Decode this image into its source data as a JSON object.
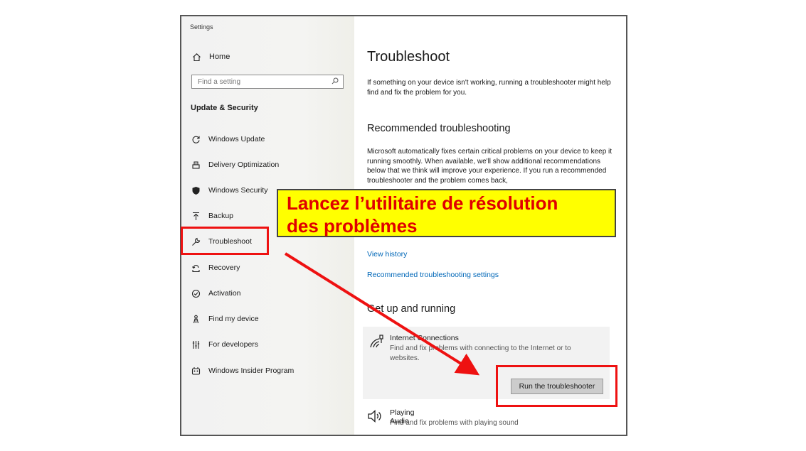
{
  "window": {
    "title": "Settings"
  },
  "sidebar": {
    "home_label": "Home",
    "search_placeholder": "Find a setting",
    "section_title": "Update & Security",
    "items": [
      {
        "label": "Windows Update",
        "icon": "refresh-icon"
      },
      {
        "label": "Delivery Optimization",
        "icon": "delivery-icon"
      },
      {
        "label": "Windows Security",
        "icon": "shield-icon"
      },
      {
        "label": "Backup",
        "icon": "backup-arrow-icon"
      },
      {
        "label": "Troubleshoot",
        "icon": "wrench-icon",
        "selected": true
      },
      {
        "label": "Recovery",
        "icon": "recovery-icon"
      },
      {
        "label": "Activation",
        "icon": "check-circle-icon"
      },
      {
        "label": "Find my device",
        "icon": "person-location-icon"
      },
      {
        "label": "For developers",
        "icon": "developer-icon"
      },
      {
        "label": "Windows Insider Program",
        "icon": "insider-icon"
      }
    ]
  },
  "main": {
    "title": "Troubleshoot",
    "intro": "If something on your device isn't working, running a troubleshooter might help find and fix the problem for you.",
    "recommended_title": "Recommended troubleshooting",
    "recommended_text": "Microsoft automatically fixes certain critical problems on your device to keep it running smoothly. When available, we'll show additional recommendations below that we think will improve your experience. If you run a recommended troubleshooter and the problem comes back,",
    "link_history": "View history",
    "link_settings": "Recommended troubleshooting settings",
    "getup_title": "Get up and running",
    "internet": {
      "title": "Internet Connections",
      "desc": "Find and fix problems with connecting to the Internet or to websites.",
      "button": "Run the troubleshooter"
    },
    "audio": {
      "title": "Playing Audio",
      "desc": "Find and fix problems with playing sound"
    }
  },
  "annotation": {
    "callout_line1": "Lancez l’utilitaire de résolution",
    "callout_line2": "des problèmes",
    "callout_bg": "#ffff00",
    "callout_text_color": "#e00000",
    "highlight_color": "#ee1111"
  },
  "colors": {
    "link": "#0067b8"
  }
}
